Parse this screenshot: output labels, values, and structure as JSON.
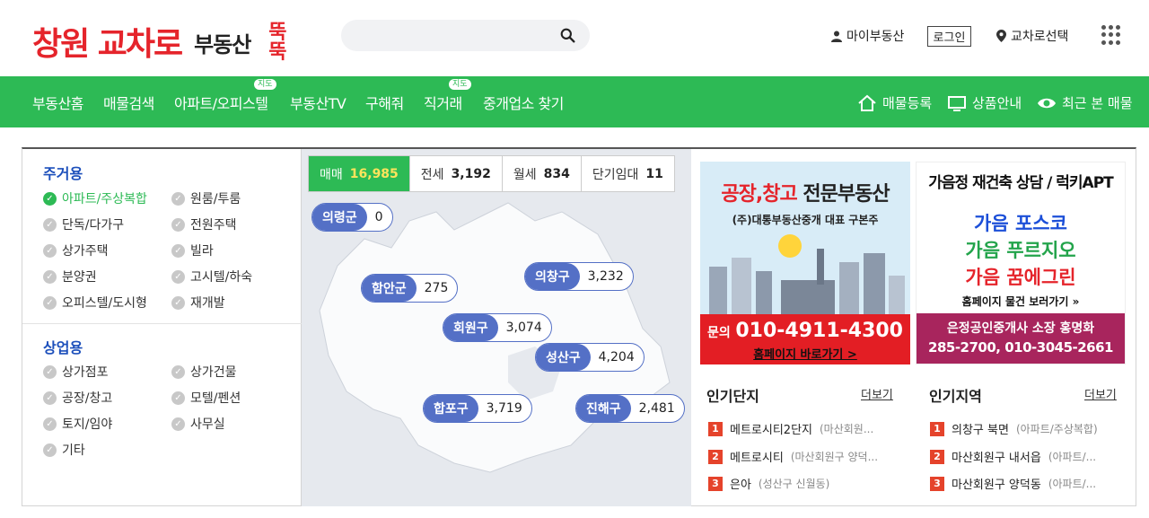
{
  "header": {
    "logo_red": "창원 교차로",
    "logo_dark": "부동산",
    "logo_ddeok_top": "뚝",
    "logo_ddeok_bottom": "뚝",
    "search_placeholder": "",
    "my_realty": "마이부동산",
    "login": "로그인",
    "select_region": "교차로선택"
  },
  "nav": {
    "items": [
      {
        "label": "부동산홈"
      },
      {
        "label": "매물검색"
      },
      {
        "label": "아파트/오피스텔",
        "badge": "지도"
      },
      {
        "label": "부동산TV"
      },
      {
        "label": "구해줘"
      },
      {
        "label": "직거래",
        "badge": "지도"
      },
      {
        "label": "중개업소 찾기"
      }
    ],
    "right": {
      "register": "매물등록",
      "products": "상품안내",
      "recent": "최근 본 매물"
    }
  },
  "residential": {
    "title": "주거용",
    "items": [
      "아파트/주상복합",
      "원룸/투룸",
      "단독/다가구",
      "전원주택",
      "상가주택",
      "빌라",
      "분양권",
      "고시텔/하숙",
      "오피스텔/도시형",
      "재개발"
    ]
  },
  "commercial": {
    "title": "상업용",
    "items": [
      "상가점포",
      "상가건물",
      "공장/창고",
      "모텔/펜션",
      "토지/임야",
      "사무실",
      "기타"
    ]
  },
  "map": {
    "tabs": [
      {
        "label": "매매",
        "count": "16,985"
      },
      {
        "label": "전세",
        "count": "3,192"
      },
      {
        "label": "월세",
        "count": "834"
      },
      {
        "label": "단기임대",
        "count": "11"
      }
    ],
    "regions": [
      {
        "name": "의령군",
        "count": "0"
      },
      {
        "name": "함안군",
        "count": "275"
      },
      {
        "name": "의창구",
        "count": "3,232"
      },
      {
        "name": "회원구",
        "count": "3,074"
      },
      {
        "name": "성산구",
        "count": "4,204"
      },
      {
        "name": "합포구",
        "count": "3,719"
      },
      {
        "name": "진해구",
        "count": "2,481"
      }
    ]
  },
  "ad1": {
    "title_red": "공장,창고",
    "title_dark": "전문부동산",
    "sub": "(주)대통부동산중개 대표 구본주",
    "phone_prefix": "문의",
    "phone": "010-4911-4300",
    "link": "홈페이지 바로가기 >"
  },
  "ad2": {
    "title": "가음정 재건축 상담 / 럭키APT",
    "lines": [
      "가음 포스코",
      "가음 푸르지오",
      "가음 꿈에그린"
    ],
    "link": "홈페이지 물건 보러가기 »",
    "office": "은정공인중개사 소장 홍명화",
    "phones": "285-2700, 010-3045-2661"
  },
  "popular_complex": {
    "title": "인기단지",
    "more": "더보기",
    "items": [
      {
        "rank": "1",
        "name": "메트로시티2단지",
        "sub": "(마산회원..."
      },
      {
        "rank": "2",
        "name": "메트로시티",
        "sub": "(마산회원구 양덕..."
      },
      {
        "rank": "3",
        "name": "은아",
        "sub": "(성산구 신월동)"
      }
    ]
  },
  "popular_area": {
    "title": "인기지역",
    "more": "더보기",
    "items": [
      {
        "rank": "1",
        "name": "의창구 북면",
        "sub": "(아파트/주상복합)"
      },
      {
        "rank": "2",
        "name": "마산회원구 내서읍",
        "sub": "(아파트/..."
      },
      {
        "rank": "3",
        "name": "마산회원구 양덕동",
        "sub": "(아파트/..."
      }
    ]
  },
  "colors": {
    "brand_green": "#2dba55",
    "logo_red": "#e5242b",
    "pill_blue": "#5470c6",
    "section_blue": "#1c4fbb"
  }
}
